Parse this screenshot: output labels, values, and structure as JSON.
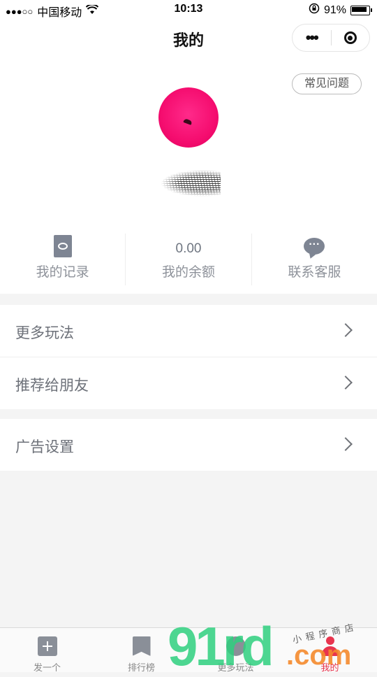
{
  "status_bar": {
    "signal": "●●●○○",
    "carrier": "中国移动",
    "wifi": "wifi-icon",
    "time": "10:13",
    "lock_icon": "rotation-lock-icon",
    "battery_text": "91%"
  },
  "nav": {
    "title": "我的",
    "more_icon": "more-dots-icon",
    "close_icon": "target-icon"
  },
  "profile": {
    "faq_label": "常见问题",
    "avatar_color": "#f50d6f",
    "stats": [
      {
        "icon": "record-icon",
        "value": "",
        "label": "我的记录"
      },
      {
        "icon": "",
        "value": "0.00",
        "label": "我的余额"
      },
      {
        "icon": "chat-icon",
        "value": "",
        "label": "联系客服"
      }
    ]
  },
  "menu": {
    "group1": [
      {
        "label": "更多玩法"
      },
      {
        "label": "推荐给朋友"
      }
    ],
    "group2": [
      {
        "label": "广告设置"
      }
    ]
  },
  "tab_bar": {
    "active_color": "#e8344e",
    "tabs": [
      {
        "label": "发一个",
        "icon": "plus-icon"
      },
      {
        "label": "排行榜",
        "icon": "bookmark-icon"
      },
      {
        "label": "更多玩法",
        "icon": "games-icon"
      },
      {
        "label": "我的",
        "icon": "person-icon"
      }
    ]
  },
  "watermark": {
    "main": "91rd",
    "suffix": ".com",
    "tagline": "小程序商店"
  }
}
